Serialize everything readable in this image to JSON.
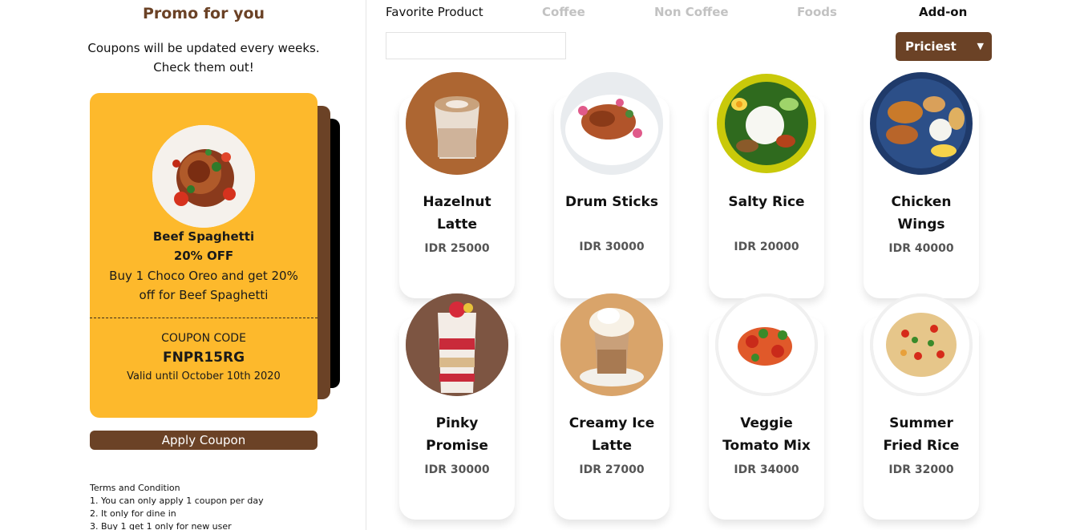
{
  "promo": {
    "title": "Promo for you",
    "subtitle_line1": "Coupons will be updated every weeks.",
    "subtitle_line2": "Check them out!",
    "coupon": {
      "name": "Beef Spaghetti",
      "discount": "20% OFF",
      "description": "Buy 1 Choco Oreo and get 20% off for Beef Spaghetti",
      "code_label": "COUPON CODE",
      "code": "FNPR15RG",
      "valid": "Valid until October 10th 2020"
    },
    "apply_label": "Apply Coupon",
    "terms": {
      "title": "Terms and Condition",
      "items": [
        "1. You can only apply 1 coupon per day",
        "2. It only for dine in",
        "3. Buy 1 get 1 only for new user"
      ]
    }
  },
  "tabs": [
    {
      "label": "Favorite Product"
    },
    {
      "label": "Coffee"
    },
    {
      "label": "Non Coffee"
    },
    {
      "label": "Foods"
    },
    {
      "label": "Add-on"
    }
  ],
  "search": {
    "placeholder": ""
  },
  "sort": {
    "selected": "Priciest"
  },
  "products": [
    {
      "name": "Hazelnut Latte",
      "price": "IDR 25000"
    },
    {
      "name": "Drum Sticks",
      "price": "IDR 30000"
    },
    {
      "name": "Salty Rice",
      "price": "IDR 20000"
    },
    {
      "name": "Chicken Wings",
      "price": "IDR 40000"
    },
    {
      "name": "Pinky Promise",
      "price": "IDR 30000"
    },
    {
      "name": "Creamy Ice Latte",
      "price": "IDR 27000"
    },
    {
      "name": "Veggie Tomato Mix",
      "price": "IDR 34000"
    },
    {
      "name": "Summer Fried Rice",
      "price": "IDR 32000"
    }
  ]
}
